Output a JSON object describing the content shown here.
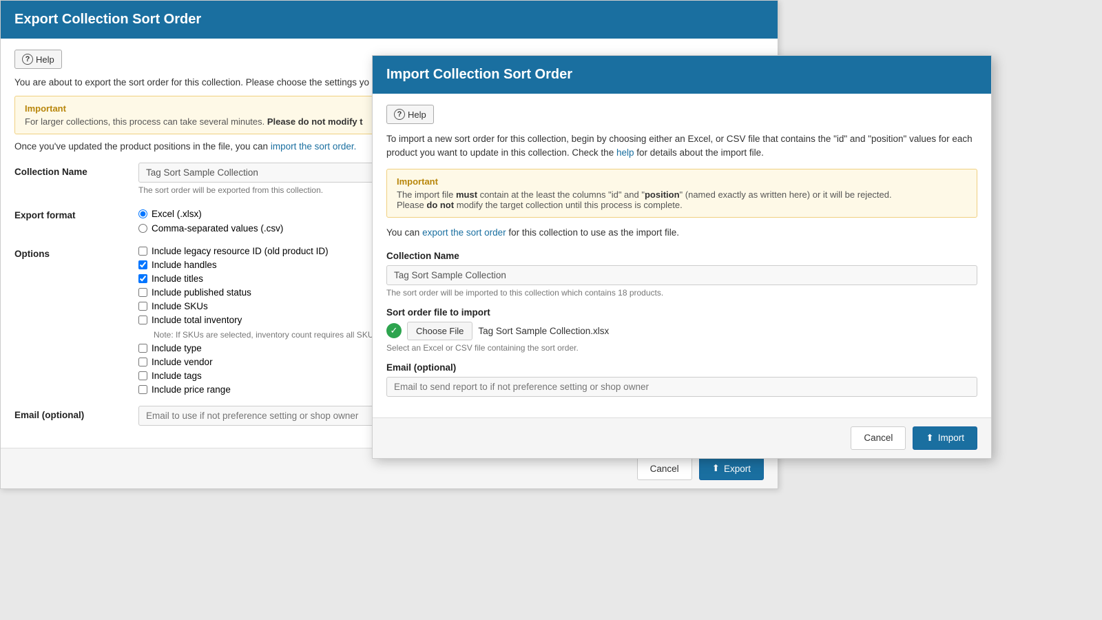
{
  "export_panel": {
    "title": "Export Collection Sort Order",
    "help_label": "Help",
    "description": "You are about to export the sort order for this collection. Please choose the settings yo",
    "import_link_text": "import the sort order.",
    "once_updated_text": "Once you've updated the product positions in the file, you can",
    "warning": {
      "title": "Important",
      "text": "For larger collections, this process can take several minutes.",
      "bold_text": "Please do not modify t"
    },
    "collection_name_label": "Collection Name",
    "collection_name_value": "Tag Sort Sample Collection",
    "collection_name_hint": "The sort order will be exported from this collection.",
    "export_format_label": "Export format",
    "format_excel": "Excel (.xlsx)",
    "format_csv": "Comma-separated values (.csv)",
    "options_label": "Options",
    "options": [
      {
        "label": "Include legacy resource ID (old product ID)",
        "checked": false
      },
      {
        "label": "Include handles",
        "checked": true
      },
      {
        "label": "Include titles",
        "checked": true
      },
      {
        "label": "Include published status",
        "checked": false
      },
      {
        "label": "Include SKUs",
        "checked": false
      },
      {
        "label": "Include total inventory",
        "checked": false
      },
      {
        "label": "Include type",
        "checked": false
      },
      {
        "label": "Include vendor",
        "checked": false
      },
      {
        "label": "Include tags",
        "checked": false
      },
      {
        "label": "Include price range",
        "checked": false
      }
    ],
    "options_note": "Note: If SKUs are selected, inventory count requires all SKUs to",
    "email_label": "Email (optional)",
    "email_placeholder": "Email to use if not preference setting or shop owner",
    "cancel_label": "Cancel",
    "export_label": "Export"
  },
  "import_panel": {
    "title": "Import Collection Sort Order",
    "help_label": "Help",
    "description_part1": "To import a new sort order for this collection, begin by choosing either an Excel, or CSV file that contains the \"id\" and \"position\" values for each product you want to update in this collection. Check the",
    "description_help_link": "help",
    "description_part2": "for details about the import file.",
    "warning": {
      "title": "Important",
      "text_part1": "The import file",
      "must_text": "must",
      "text_part2": "contain at the least the columns \"id\" and \"",
      "position_text": "position",
      "text_part3": "\" (named exactly as written here) or it will be rejected.",
      "text_part4": "Please",
      "do_not_text": "do not",
      "text_part5": "modify the target collection until this process is complete."
    },
    "export_link_text": "export the sort order",
    "export_link_context": "You can",
    "export_link_suffix": "for this collection to use as the import file.",
    "collection_name_label": "Collection Name",
    "collection_name_value": "Tag Sort Sample Collection",
    "collection_name_hint": "The sort order will be imported to this collection which contains 18 products.",
    "sort_file_label": "Sort order file to import",
    "file_name": "Tag Sort Sample Collection.xlsx",
    "file_hint": "Select an Excel or CSV file containing the sort order.",
    "choose_file_label": "Choose File",
    "email_label": "Email (optional)",
    "email_placeholder": "Email to send report to if not preference setting or shop owner",
    "cancel_label": "Cancel",
    "import_label": "Import"
  }
}
